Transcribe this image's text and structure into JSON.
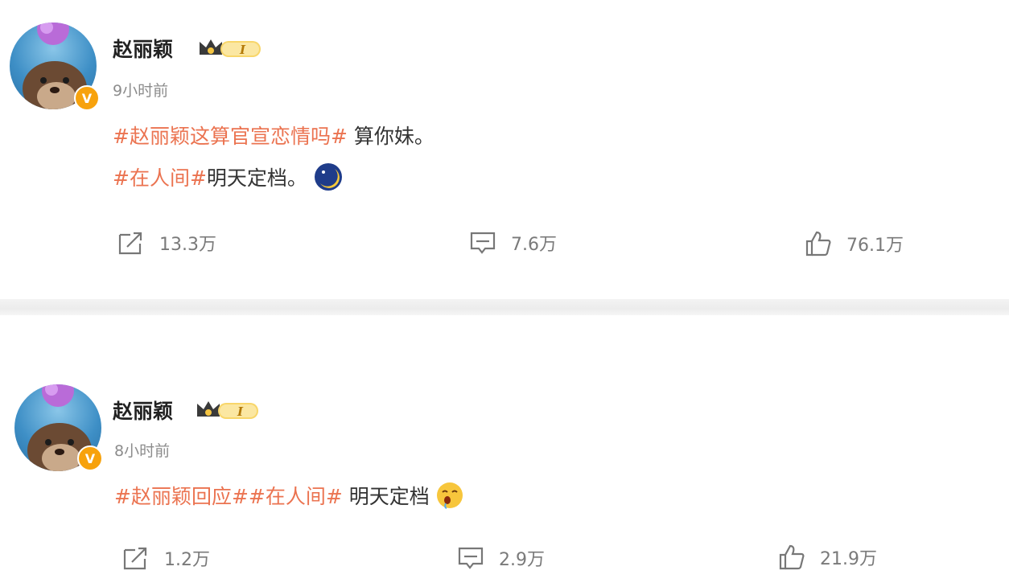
{
  "posts": [
    {
      "author": "赵丽颖",
      "level_badge": "I",
      "time": "9小时前",
      "lines": [
        {
          "topic": "#赵丽颖这算官宣恋情吗#",
          "text": " 算你妹。"
        },
        {
          "topic": "#在人间#",
          "text": "明天定档。"
        }
      ],
      "emoji": "moon-emoji",
      "repost_count": "13.3万",
      "comment_count": "7.6万",
      "like_count": "76.1万"
    },
    {
      "author": "赵丽颖",
      "level_badge": "I",
      "time": "8小时前",
      "lines": [
        {
          "topic": "#赵丽颖回应##在人间#",
          "text": " 明天定档"
        }
      ],
      "emoji": "drool-emoji",
      "repost_count": "1.2万",
      "comment_count": "2.9万",
      "like_count": "21.9万"
    }
  ],
  "colors": {
    "topic": "#eb7350",
    "badge": "#f7a20d",
    "muted": "#8c8c8c"
  }
}
